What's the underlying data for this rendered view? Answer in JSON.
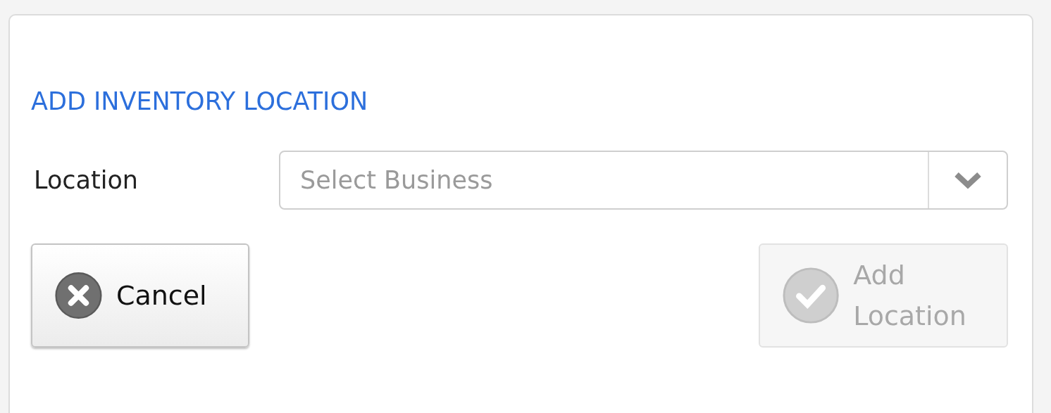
{
  "title": "ADD INVENTORY LOCATION",
  "location_field": {
    "label": "Location",
    "placeholder": "Select Business"
  },
  "buttons": [
    {
      "kind": "cancel",
      "label": "Cancel",
      "disabled": false
    },
    {
      "kind": "confirm",
      "label": "Add Location",
      "disabled": true
    }
  ]
}
